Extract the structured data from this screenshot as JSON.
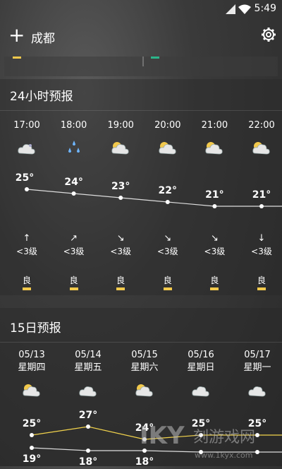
{
  "status": {
    "time": "5:49"
  },
  "header": {
    "city": "成都"
  },
  "hourly": {
    "title": "24小时预报",
    "items": [
      {
        "time": "17:00",
        "icon": "partly-cloudy-icon",
        "temp": "25°",
        "wind_dir": "↑",
        "wind": "<3级",
        "aq": "良"
      },
      {
        "time": "18:00",
        "icon": "rain-drops-icon",
        "temp": "24°",
        "wind_dir": "↗",
        "wind": "<3级",
        "aq": "良"
      },
      {
        "time": "19:00",
        "icon": "sun-cloud-icon",
        "temp": "23°",
        "wind_dir": "↘",
        "wind": "<3级",
        "aq": "良"
      },
      {
        "time": "20:00",
        "icon": "sun-cloud-icon",
        "temp": "22°",
        "wind_dir": "↘",
        "wind": "<3级",
        "aq": "良"
      },
      {
        "time": "21:00",
        "icon": "sun-cloud-icon",
        "temp": "21°",
        "wind_dir": "↘",
        "wind": "<3级",
        "aq": "良"
      },
      {
        "time": "22:00",
        "icon": "sun-cloud-icon",
        "temp": "21°",
        "wind_dir": "↓",
        "wind": "<3级",
        "aq": "良"
      }
    ]
  },
  "daily": {
    "title": "15日预报",
    "items": [
      {
        "date": "05/13",
        "weekday": "星期四",
        "icon": "sun-cloud-icon",
        "high": "25°",
        "low": "19°"
      },
      {
        "date": "05/14",
        "weekday": "星期五",
        "icon": "cloud-icon",
        "high": "27°",
        "low": "18°"
      },
      {
        "date": "05/15",
        "weekday": "星期六",
        "icon": "sun-cloud-icon",
        "high": "24°",
        "low": "18°"
      },
      {
        "date": "05/16",
        "weekday": "星期日",
        "icon": "cloud-icon",
        "high": "25°",
        "low": ""
      },
      {
        "date": "05/17",
        "weekday": "星期一",
        "icon": "cloud-icon",
        "high": "25°",
        "low": ""
      }
    ]
  },
  "watermark": {
    "text": "刻游戏网",
    "url": "www.1kyx.com"
  }
}
